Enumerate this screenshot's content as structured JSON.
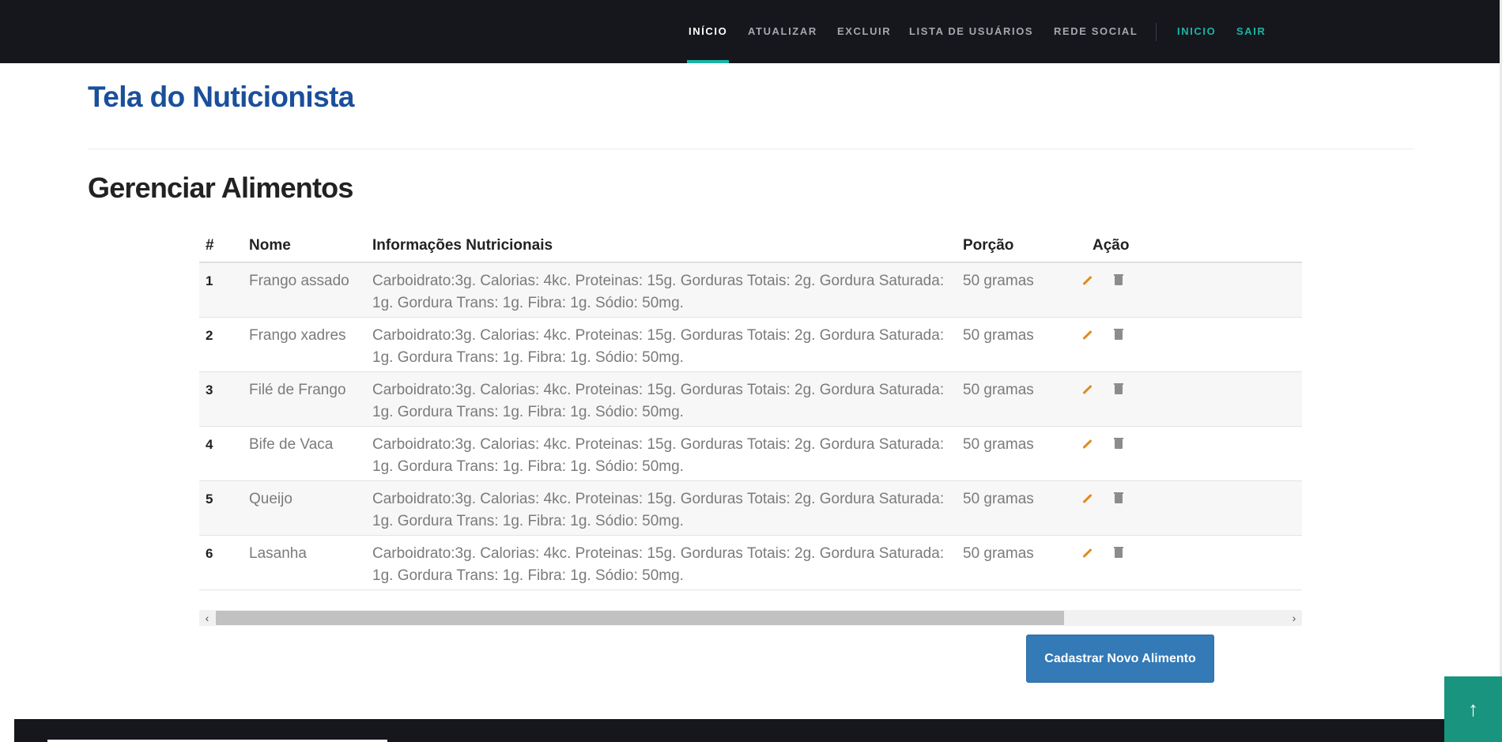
{
  "nav": {
    "items": [
      {
        "label": "INÍCIO",
        "active": true,
        "accent": false
      },
      {
        "label": "ATUALIZAR",
        "active": false,
        "accent": false
      },
      {
        "label": "EXCLUIR",
        "active": false,
        "accent": false
      },
      {
        "label": "LISTA DE USUÁRIOS",
        "active": false,
        "accent": false
      },
      {
        "label": "REDE SOCIAL",
        "active": false,
        "accent": false
      },
      {
        "label": "INICIO",
        "active": false,
        "accent": true
      },
      {
        "label": "SAIR",
        "active": false,
        "accent": true
      }
    ],
    "colors": {
      "background": "#15171c",
      "accent": "#1ab5a6",
      "text": "#a4a7ad"
    }
  },
  "page": {
    "title": "Tela do Nuticionista",
    "section_title": "Gerenciar Alimentos"
  },
  "table": {
    "headers": {
      "num": "#",
      "name": "Nome",
      "info": "Informações Nutricionais",
      "portion": "Porção",
      "action": "Ação"
    },
    "rows": [
      {
        "num": "1",
        "name": "Frango assado",
        "info": "Carboidrato:3g. Calorias: 4kc. Proteinas: 15g. Gorduras Totais: 2g. Gordura Saturada: 1g. Gordura Trans: 1g. Fibra: 1g. Sódio: 50mg.",
        "portion": "50 gramas"
      },
      {
        "num": "2",
        "name": "Frango xadres",
        "info": "Carboidrato:3g. Calorias: 4kc. Proteinas: 15g. Gorduras Totais: 2g. Gordura Saturada: 1g. Gordura Trans: 1g. Fibra: 1g. Sódio: 50mg.",
        "portion": "50 gramas"
      },
      {
        "num": "3",
        "name": "Filé de Frango",
        "info": "Carboidrato:3g. Calorias: 4kc. Proteinas: 15g. Gorduras Totais: 2g. Gordura Saturada: 1g. Gordura Trans: 1g. Fibra: 1g. Sódio: 50mg.",
        "portion": "50 gramas"
      },
      {
        "num": "4",
        "name": "Bife de Vaca",
        "info": "Carboidrato:3g. Calorias: 4kc. Proteinas: 15g. Gorduras Totais: 2g. Gordura Saturada: 1g. Gordura Trans: 1g. Fibra: 1g. Sódio: 50mg.",
        "portion": "50 gramas"
      },
      {
        "num": "5",
        "name": "Queijo",
        "info": "Carboidrato:3g. Calorias: 4kc. Proteinas: 15g. Gorduras Totais: 2g. Gordura Saturada: 1g. Gordura Trans: 1g. Fibra: 1g. Sódio: 50mg.",
        "portion": "50 gramas"
      },
      {
        "num": "6",
        "name": "Lasanha",
        "info": "Carboidrato:3g. Calorias: 4kc. Proteinas: 15g. Gorduras Totais: 2g. Gordura Saturada: 1g. Gordura Trans: 1g. Fibra: 1g. Sódio: 50mg.",
        "portion": "50 gramas"
      }
    ],
    "action_icons": [
      "pencil-icon",
      "trash-icon"
    ]
  },
  "scrollbar": {
    "arrow_left": "‹",
    "arrow_right": "›"
  },
  "buttons": {
    "add_food": "Cadastrar Novo Alimento",
    "back_to_top": "↑"
  }
}
